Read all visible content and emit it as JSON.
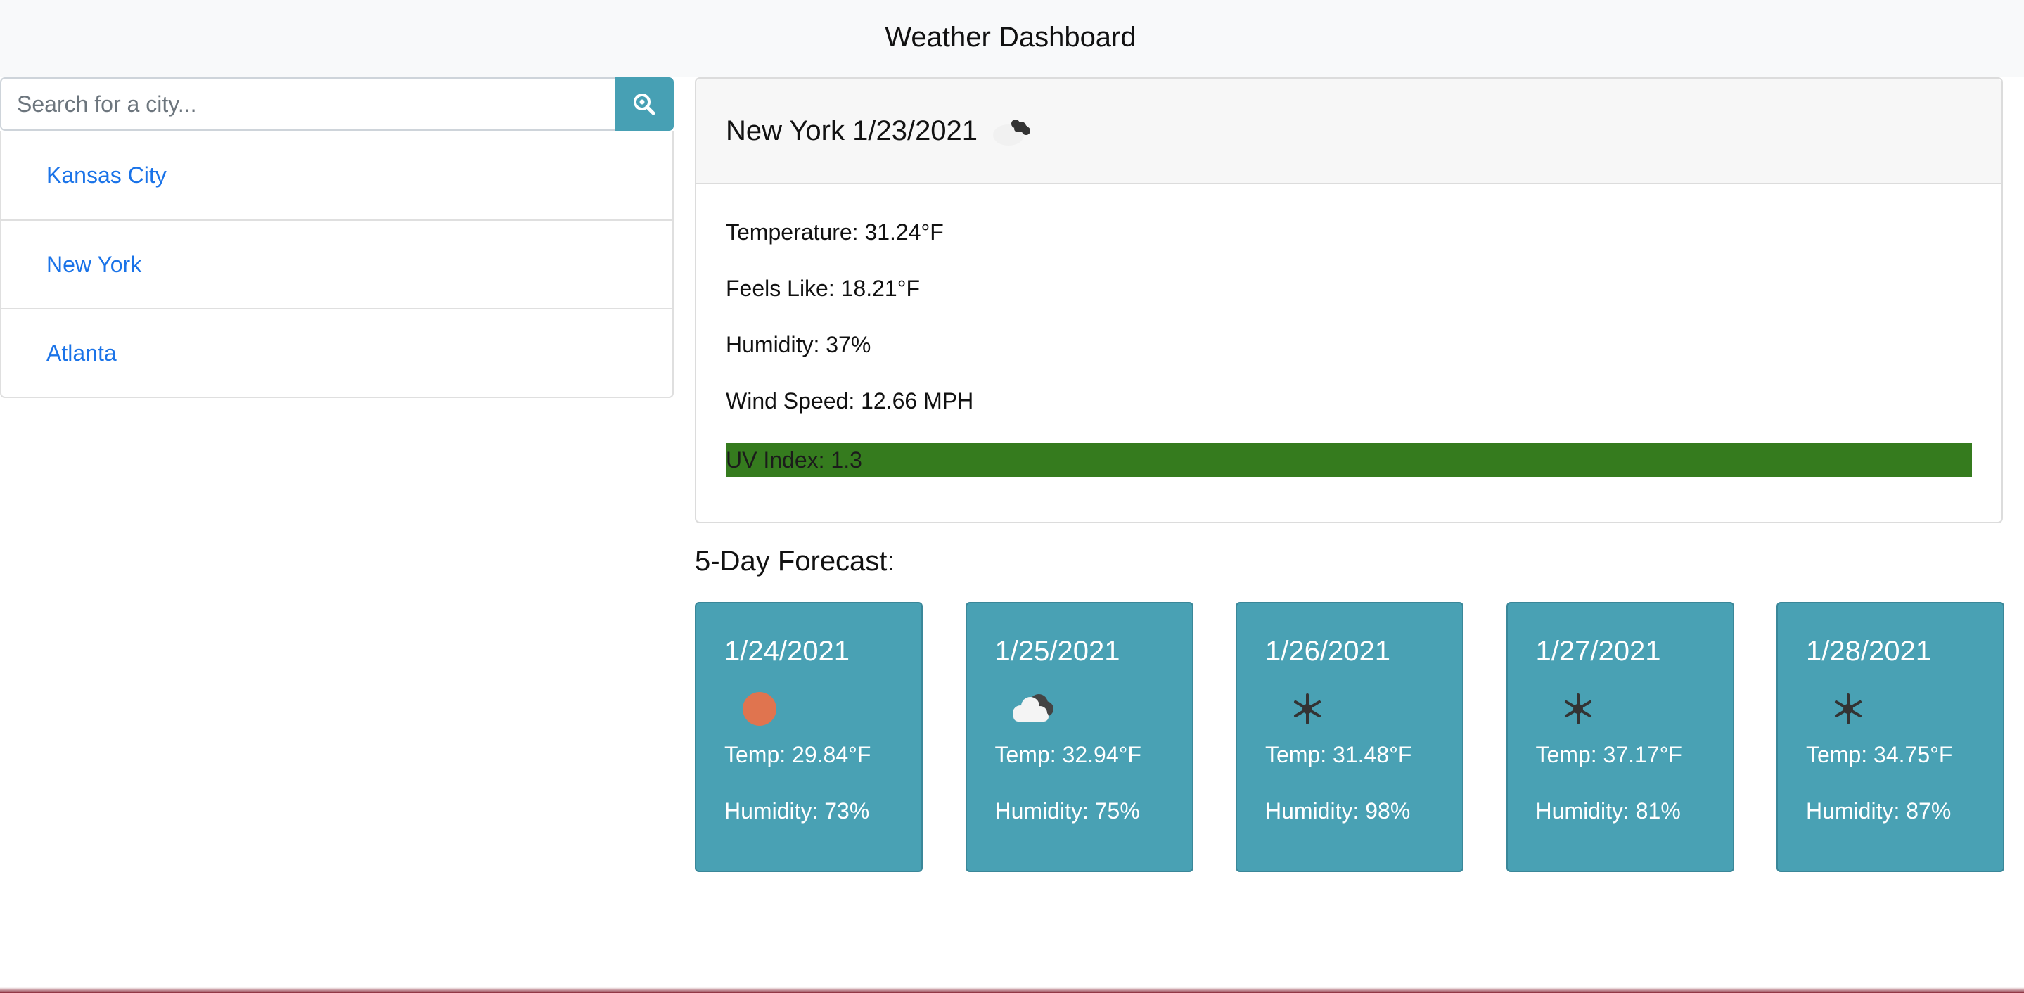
{
  "header": {
    "title": "Weather Dashboard"
  },
  "search": {
    "placeholder": "Search for a city...",
    "button_icon": "search-icon"
  },
  "cities": [
    {
      "label": "Kansas City"
    },
    {
      "label": "New York"
    },
    {
      "label": "Atlanta"
    }
  ],
  "current": {
    "title": "New York 1/23/2021",
    "icon": "broken-clouds-icon",
    "temperature": "Temperature: 31.24°F",
    "feels_like": "Feels Like: 18.21°F",
    "humidity": "Humidity: 37%",
    "wind": "Wind Speed: 12.66 MPH",
    "uv": "UV Index: 1.3",
    "uv_color": "#357b1e"
  },
  "forecast": {
    "title": "5-Day Forecast:",
    "days": [
      {
        "date": "1/24/2021",
        "icon": "sun-icon",
        "temp": "Temp: 29.84°F",
        "humidity": "Humidity: 73%"
      },
      {
        "date": "1/25/2021",
        "icon": "cloud-icon",
        "temp": "Temp: 32.94°F",
        "humidity": "Humidity: 75%"
      },
      {
        "date": "1/26/2021",
        "icon": "snowflake-icon",
        "temp": "Temp: 31.48°F",
        "humidity": "Humidity: 98%"
      },
      {
        "date": "1/27/2021",
        "icon": "snowflake-icon",
        "temp": "Temp: 37.17°F",
        "humidity": "Humidity: 81%"
      },
      {
        "date": "1/28/2021",
        "icon": "snowflake-icon",
        "temp": "Temp: 34.75°F",
        "humidity": "Humidity: 87%"
      }
    ]
  },
  "colors": {
    "accent": "#47a0b4",
    "link": "#1a73e8",
    "card_bg": "#49a1b4",
    "sun": "#e0744f"
  }
}
